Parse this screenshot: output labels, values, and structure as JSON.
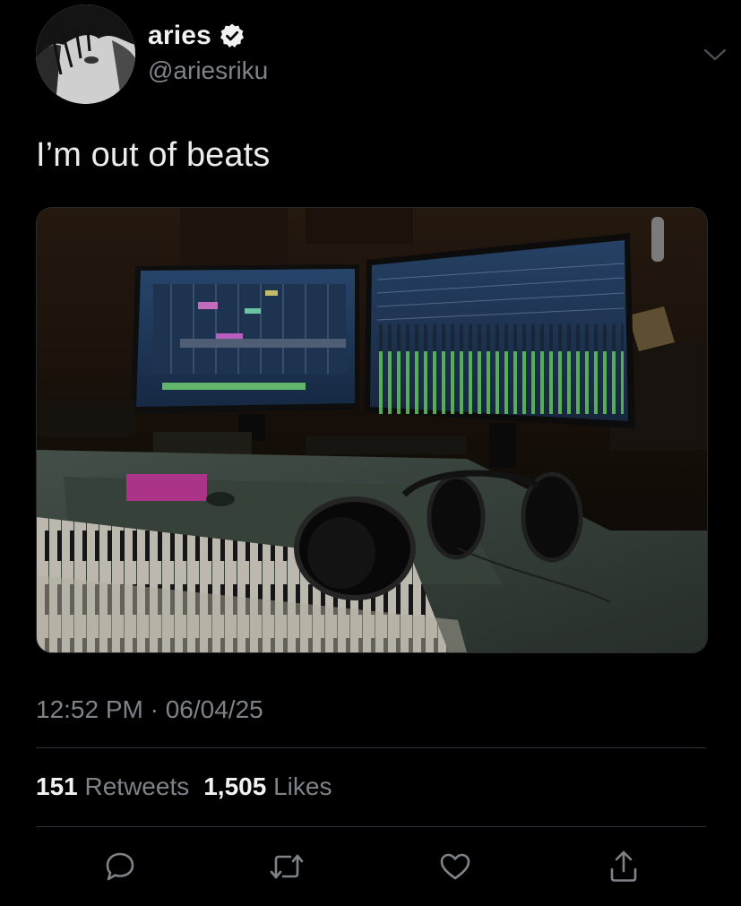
{
  "author": {
    "display_name": "aries",
    "handle": "@ariesriku",
    "verified": true,
    "avatar_icon": "profile-photo"
  },
  "tweet": {
    "text": "I’m out of beats",
    "media_description_icon": "studio-photo",
    "timestamp": "12:52 PM · 06/04/25"
  },
  "stats": {
    "retweets_count": "151",
    "retweets_label": "Retweets",
    "likes_count": "1,505",
    "likes_label": "Likes"
  },
  "actions": {
    "reply_icon": "reply-icon",
    "retweet_icon": "retweet-icon",
    "like_icon": "heart-icon",
    "share_icon": "share-icon"
  },
  "colors": {
    "background": "#000000",
    "text_primary": "#ececec",
    "text_secondary": "#7e8388",
    "divider": "#2e3236",
    "icon": "#7e8388"
  }
}
